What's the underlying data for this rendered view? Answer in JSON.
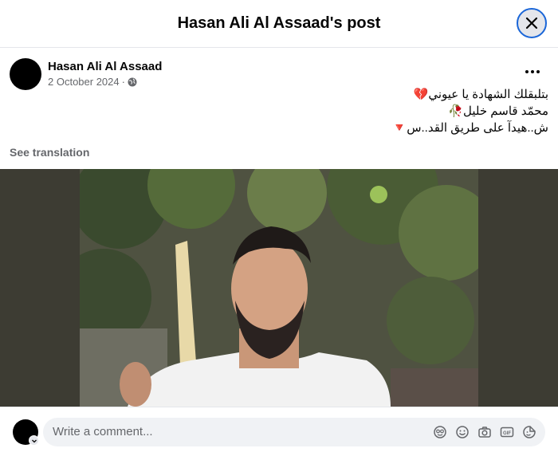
{
  "header": {
    "title": "Hasan Ali Al Assaad's post",
    "close_icon": "close-icon"
  },
  "post": {
    "author": "Hasan Ali Al Assaad",
    "date": "2 October 2024",
    "separator": "·",
    "privacy_icon": "globe-icon",
    "more_icon": "more-options-icon",
    "text_lines": [
      "بتلبقلك الشهادة يا عيوني💔",
      "محمّد قاسم خليل🥀",
      "ش..هيدآ على طريق القد..س🔻"
    ],
    "see_translation": "See translation",
    "media_icon": "photo-of-man-with-beard"
  },
  "comment": {
    "placeholder": "Write a comment...",
    "tools": [
      "avatar-sticker-icon",
      "emoji-icon",
      "camera-icon",
      "gif-icon",
      "sticker-icon"
    ]
  },
  "colors": {
    "accent": "#1a66d8",
    "text_secondary": "#65676b",
    "input_bg": "#f0f2f5",
    "media_bg": "#3d3c33"
  }
}
